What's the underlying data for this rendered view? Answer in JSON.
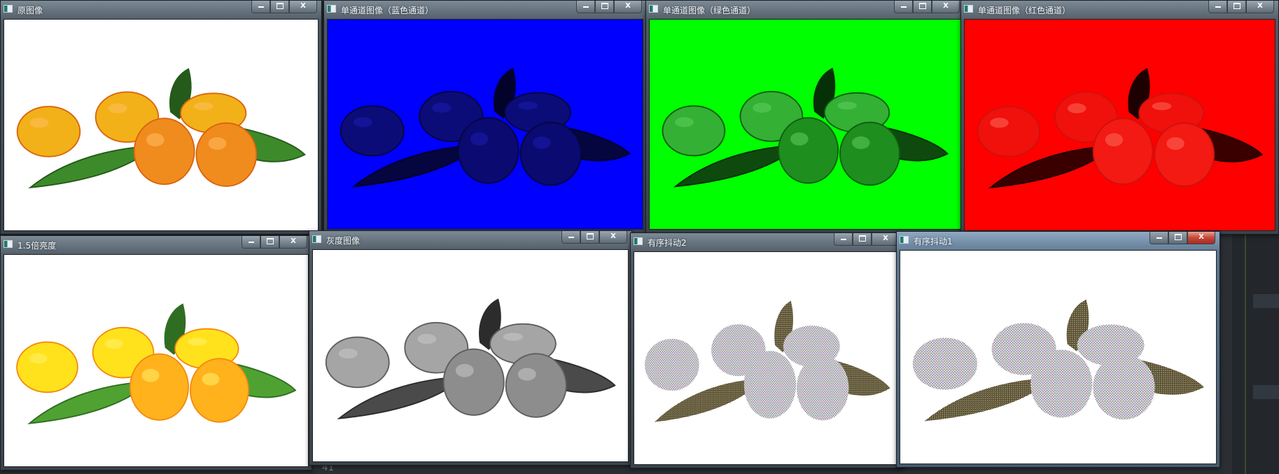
{
  "windows": [
    {
      "id": "original",
      "title": "原图像",
      "mode": "original",
      "bg": "#ffffff",
      "active": false
    },
    {
      "id": "blue",
      "title": "单通道图像（蓝色通道）",
      "mode": "blue",
      "bg": "#0000ff",
      "active": false
    },
    {
      "id": "green",
      "title": "单通道图像（绿色通道）",
      "mode": "green",
      "bg": "#00ff00",
      "active": false
    },
    {
      "id": "red",
      "title": "单通道图像（红色通道）",
      "mode": "red",
      "bg": "#ff0000",
      "active": false
    },
    {
      "id": "bright",
      "title": "1.5倍亮度",
      "mode": "bright",
      "bg": "#ffffff",
      "active": false
    },
    {
      "id": "gray",
      "title": "灰度图像",
      "mode": "gray",
      "bg": "#ffffff",
      "active": false
    },
    {
      "id": "dither2",
      "title": "有序抖动2",
      "mode": "dither2",
      "bg": "#ffffff",
      "active": false
    },
    {
      "id": "dither1",
      "title": "有序抖动1",
      "mode": "dither1",
      "bg": "#ffffff",
      "active": true
    }
  ],
  "controls": {
    "minimize": "minimize",
    "maximize": "maximize",
    "close": "X"
  },
  "editor": {
    "line_number": "41"
  }
}
